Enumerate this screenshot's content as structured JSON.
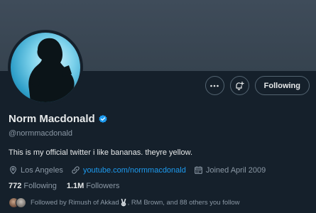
{
  "profile": {
    "name": "Norm Macdonald",
    "handle": "@normmacdonald",
    "bio": "This is my official twitter i like bananas. theyre yellow.",
    "location": "Los Angeles",
    "website": "youtube.com/normmacdonald",
    "joined": "Joined April 2009"
  },
  "stats": {
    "following_count": "772",
    "following_label": "Following",
    "followers_count": "1.1M",
    "followers_label": "Followers"
  },
  "followed_by": {
    "prefix": "Followed by Rimush of Akkad",
    "suffix": ", RM Brown, and 88 others you follow"
  },
  "actions": {
    "following_label": "Following"
  },
  "icons": {
    "more": "more-icon",
    "notify": "bell-plus-icon",
    "location": "location-pin-icon",
    "link": "link-icon",
    "calendar": "calendar-icon",
    "verified": "verified-badge-icon"
  },
  "colors": {
    "background": "#15202b",
    "banner": "#3f4c5a",
    "accent": "#1d9bf0",
    "secondary_text": "#8b98a5"
  }
}
